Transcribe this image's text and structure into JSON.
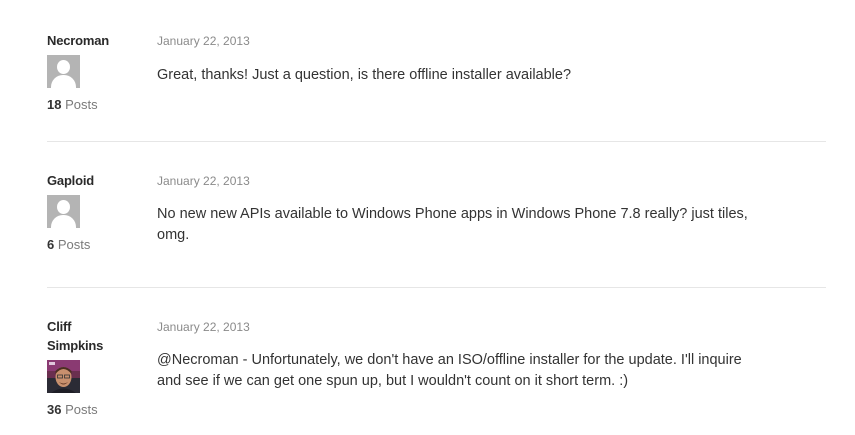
{
  "posts": [
    {
      "author": "Necroman",
      "post_count": "18",
      "posts_label": "Posts",
      "date": "January 22, 2013",
      "body": "Great, thanks! Just a question, is there offline installer available?",
      "avatar": "default-user-icon"
    },
    {
      "author": "Gaploid",
      "post_count": "6",
      "posts_label": "Posts",
      "date": "January 22, 2013",
      "body": "No new new APIs available to Windows Phone apps in Windows Phone 7.8 really? just tiles, omg.",
      "avatar": "default-user-icon"
    },
    {
      "author_line1": "Cliff",
      "author_line2": "Simpkins",
      "post_count": "36",
      "posts_label": "Posts",
      "date": "January 22, 2013",
      "body": "@Necroman - Unfortunately, we don't have an ISO/offline installer for the update. I'll inquire and see if we can get one spun up, but I wouldn't count on it short term. :)",
      "avatar": "user-photo"
    }
  ],
  "colors": {
    "author": "#2a2a2a",
    "date": "#8a8a8a",
    "body_text": "#333333",
    "divider": "#e6e6e6",
    "default_avatar_bg": "#b4b4b4"
  }
}
